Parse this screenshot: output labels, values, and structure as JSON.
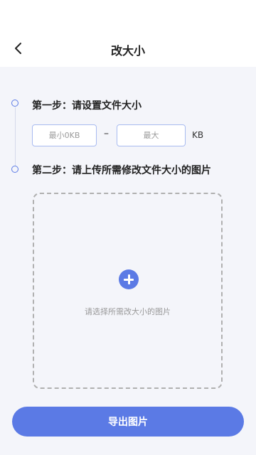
{
  "header": {
    "title": "改大小",
    "back_icon": "chevron-left-icon"
  },
  "steps": {
    "step1_label": "第一步：请设置文件大小",
    "step2_label": "第二步：请上传所需修改文件大小的图片"
  },
  "size": {
    "min_placeholder": "最小0KB",
    "min_value": "",
    "max_placeholder": "最大",
    "max_value": "",
    "separator": "–",
    "unit": "KB"
  },
  "upload": {
    "hint": "请选择所需改大小的图片",
    "icon": "add-circle-icon"
  },
  "export_button": {
    "label": "导出图片"
  },
  "colors": {
    "accent": "#5b7ae5",
    "background": "#f4f5fa"
  }
}
